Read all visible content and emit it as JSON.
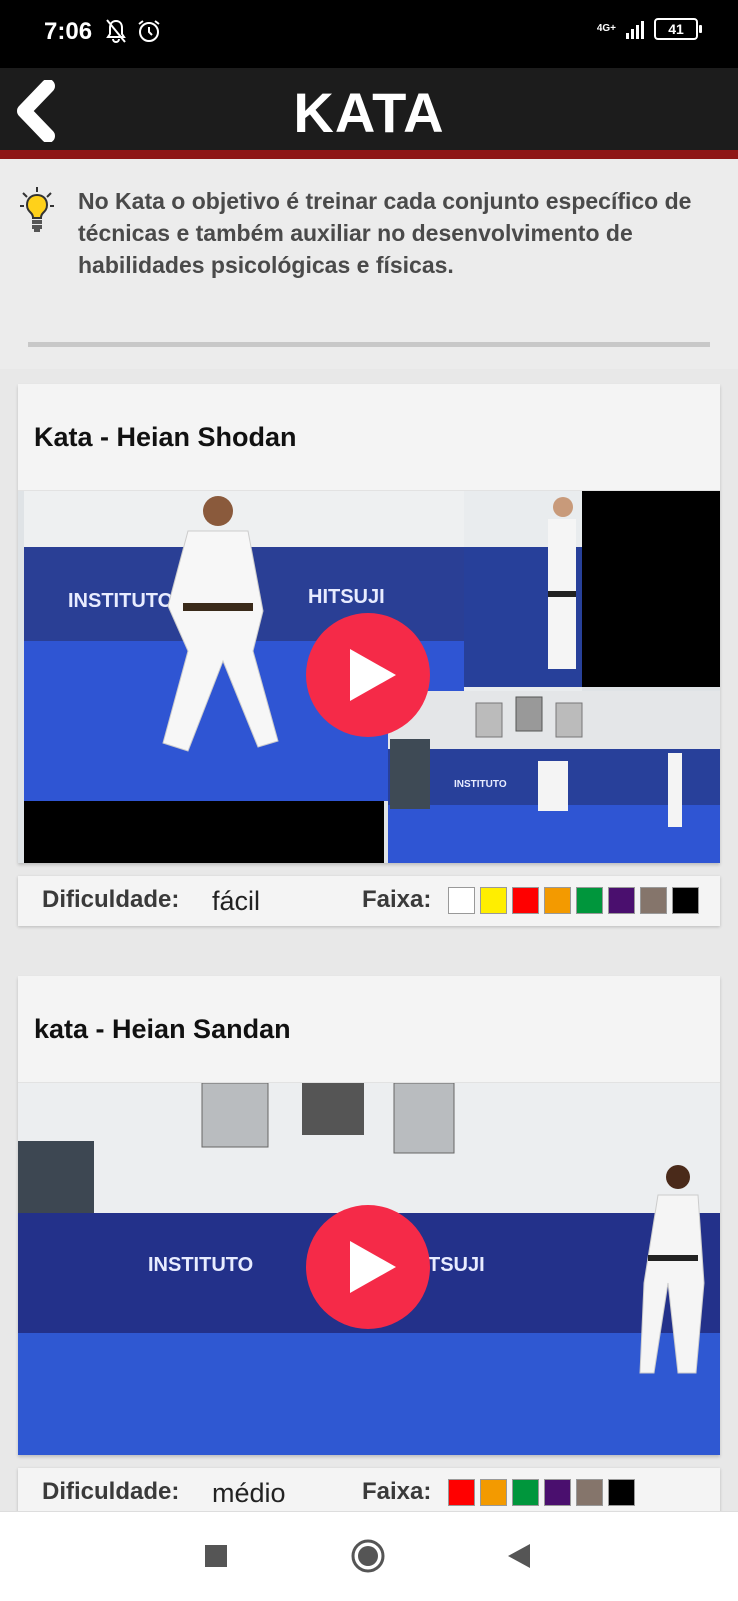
{
  "status_bar": {
    "time": "7:06",
    "network": "4G+",
    "battery": "41"
  },
  "app_bar": {
    "title": "KATA"
  },
  "info": {
    "text": "No Kata o objetivo é treinar cada conjunto específico de técnicas e também auxiliar no desenvolvimento de habilidades psicológicas e físicas."
  },
  "cards": [
    {
      "title": "Kata - Heian Shodan",
      "difficulty_label": "Dificuldade:",
      "difficulty": "fácil",
      "belt_label": "Faixa:",
      "belts": [
        "#ffffff",
        "#ffee00",
        "#ff0000",
        "#f39a00",
        "#00963c",
        "#4a0f6e",
        "#85756b",
        "#000000"
      ]
    },
    {
      "title": "kata - Heian Sandan",
      "difficulty_label": "Dificuldade:",
      "difficulty": "médio",
      "belt_label": "Faixa:",
      "belts": [
        "#ff0000",
        "#f39a00",
        "#00963c",
        "#4a0f6e",
        "#85756b",
        "#000000"
      ]
    }
  ],
  "colors": {
    "app_bar": "#1c1c1c",
    "accent_line": "#8e1616",
    "play_button": "#f52a48",
    "mat_blue": "#2d4fcf"
  },
  "nav_bar": {
    "icons": [
      "recents-square-icon",
      "home-circle-icon",
      "back-triangle-icon"
    ]
  }
}
